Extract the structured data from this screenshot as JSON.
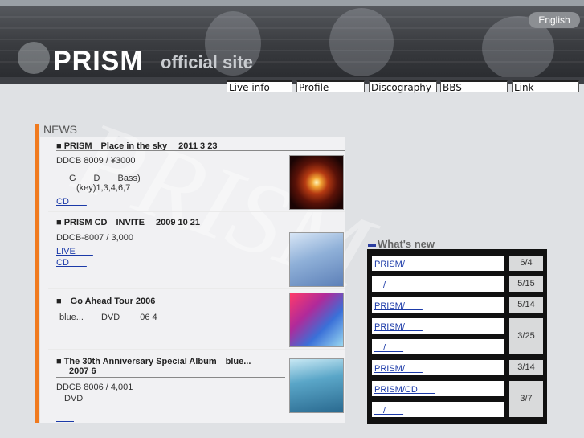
{
  "header": {
    "logo": "PRISM",
    "subtitle": "official site",
    "language_button": "English"
  },
  "nav": [
    "Live info",
    "Profile",
    "Discography",
    "BBS",
    "Link"
  ],
  "news": {
    "title": "NEWS",
    "items": [
      {
        "heading": "■ PRISM　Place in the sky　 2011  3  23",
        "lines": [
          "DDCB 8009 / ¥3000",
          "G　　D　　Bass)",
          "(key)1,3,4,6,7"
        ],
        "links": [
          "CD　　"
        ]
      },
      {
        "heading": "■ PRISM CD　INVITE　 2009  10  21",
        "lines": [
          "DDCB-8007 / 3,000"
        ],
        "links": [
          "LIVE　　",
          "CD　　"
        ]
      },
      {
        "heading": "■　Go Ahead Tour 2006",
        "lines": [
          "blue...　　DVD　　 06  4"
        ],
        "links": [
          "　　"
        ]
      },
      {
        "heading": "■ The 30th Anniversary Special Album　blue...",
        "heading2": "2007  6",
        "lines": [
          "DDCB 8006 / 4,001",
          "DVD"
        ],
        "links": [
          "　　"
        ]
      }
    ]
  },
  "whats_new": {
    "title": "What's new",
    "rows": [
      {
        "link": "PRISM/　　",
        "date": "6/4"
      },
      {
        "link": "　/　　",
        "date": "5/15"
      },
      {
        "link": "PRISM/　　",
        "date": "5/14"
      },
      {
        "link": "PRISM/　　",
        "date": "3/25"
      },
      {
        "link": "　/　　",
        "date": ""
      },
      {
        "link": "PRISM/　　",
        "date": "3/14"
      },
      {
        "link": "PRISM/CD　　",
        "date": "3/7"
      },
      {
        "link": "　/　　",
        "date": ""
      }
    ]
  },
  "watermark": "PRISM"
}
